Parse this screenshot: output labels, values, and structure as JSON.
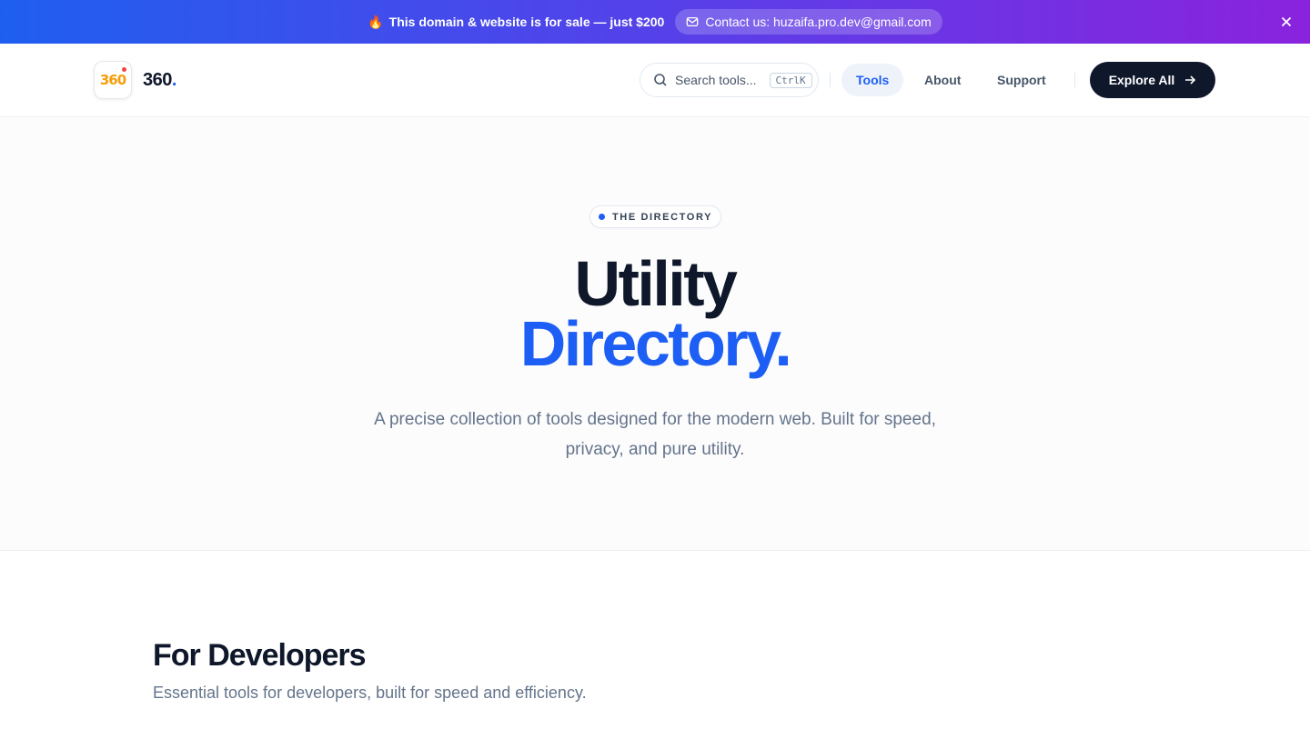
{
  "promo": {
    "icon": "fire-icon",
    "text": "This domain & website is for sale — just $200",
    "contact_label": "Contact us: huzaifa.pro.dev@gmail.com"
  },
  "header": {
    "brand": "360",
    "brand_dot": ".",
    "logo_text": "360",
    "search_placeholder": "Search tools...",
    "search_shortcut": "CtrlK",
    "nav": [
      {
        "label": "Tools",
        "active": true
      },
      {
        "label": "About",
        "active": false
      },
      {
        "label": "Support",
        "active": false
      }
    ],
    "cta_label": "Explore All"
  },
  "hero": {
    "badge": "THE DIRECTORY",
    "title_line1": "Utility",
    "title_line2": "Directory.",
    "subtitle": "A precise collection of tools designed for the modern web. Built for speed, privacy, and pure utility."
  },
  "section": {
    "title": "For Developers",
    "subtitle": "Essential tools for developers, built for speed and efficiency."
  },
  "colors": {
    "accent": "#1d5ff5",
    "dark": "#0f172a",
    "banner_start": "#1f5ff0",
    "banner_end": "#8a23dd"
  }
}
